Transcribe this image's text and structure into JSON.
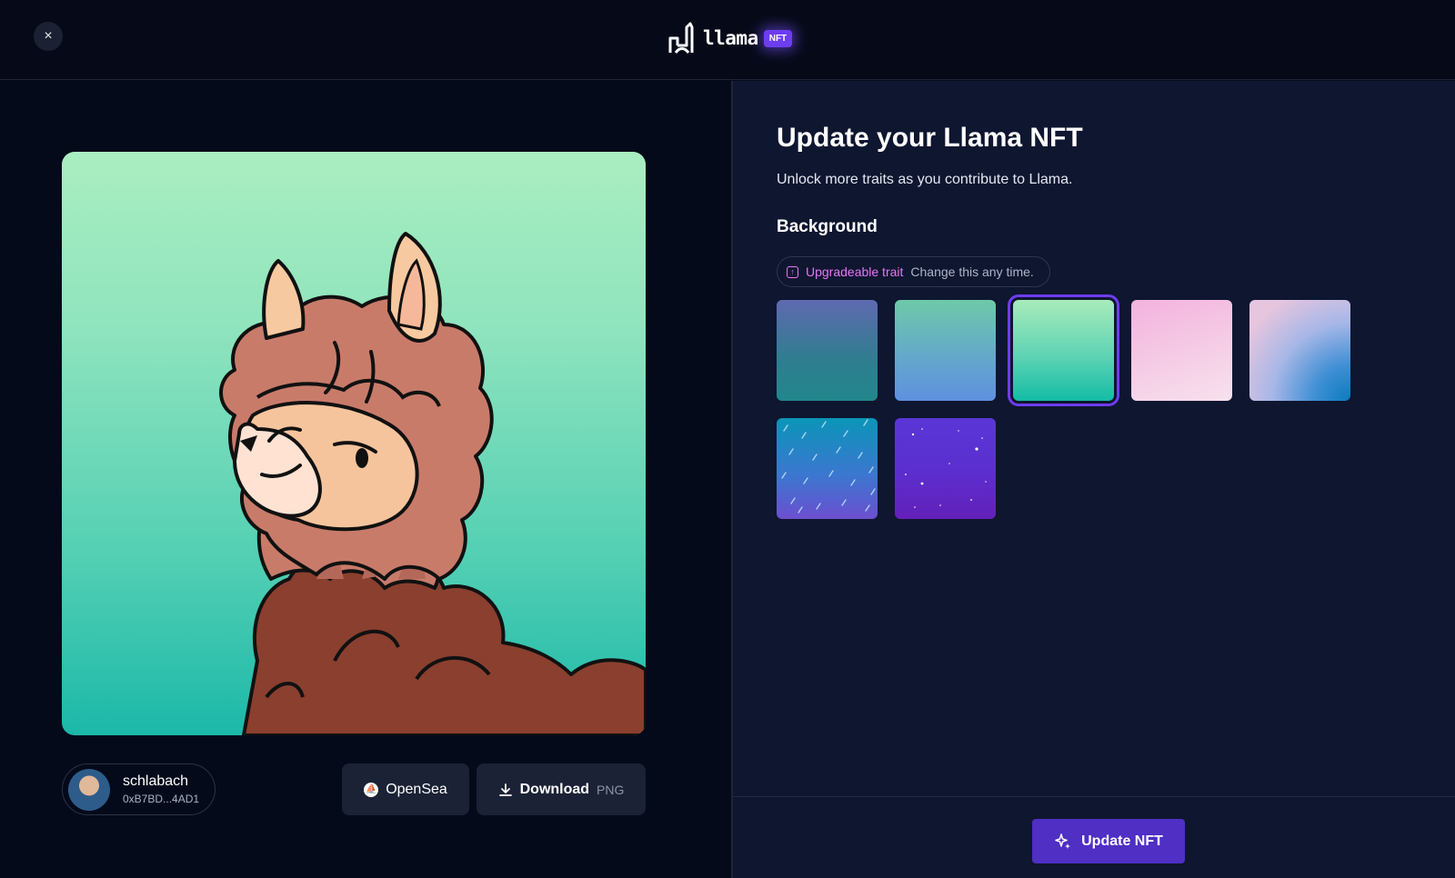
{
  "header": {
    "close_label": "×",
    "brand_name": "llama",
    "brand_badge": "NFT"
  },
  "owner": {
    "name": "schlabach",
    "address": "0xB7BD...4AD1"
  },
  "actions": {
    "opensea_label": "OpenSea",
    "download_label": "Download",
    "download_format": "PNG"
  },
  "panel": {
    "title": "Update your Llama NFT",
    "subtitle": "Unlock more traits as you contribute to Llama.",
    "section_label": "Background",
    "trait_label": "Upgradeable trait",
    "trait_note": "Change this any time."
  },
  "backgrounds": {
    "selected_index": 2,
    "count": 7
  },
  "footer": {
    "update_label": "Update NFT"
  },
  "colors": {
    "accent": "#6d3df0",
    "trait_pink": "#e677f5",
    "panel_bg": "#0e1630",
    "page_bg": "#050a1a"
  },
  "icons": {
    "close": "close-icon",
    "opensea": "opensea-icon",
    "download": "download-icon",
    "trait": "upgrade-icon",
    "update": "sparkle-icon"
  }
}
